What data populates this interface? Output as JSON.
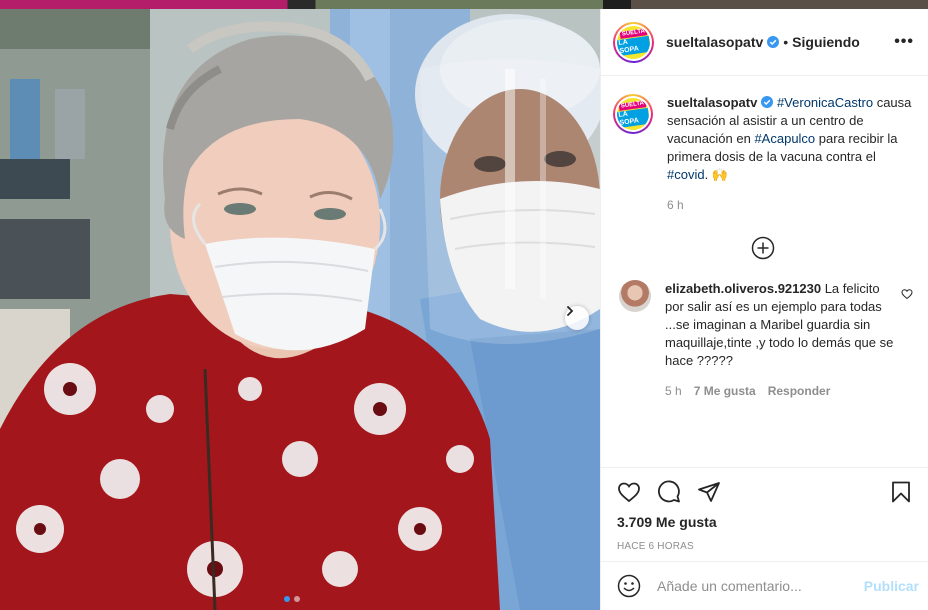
{
  "post": {
    "username": "sueltalasopatv",
    "follow_status": "Siguiendo",
    "bullet": "•",
    "more": "•••",
    "logo_line1": "SUELTA",
    "logo_line2": "LA SOPA"
  },
  "caption": {
    "username": "sueltalasopatv",
    "tag1": "#VeronicaCastro",
    "text1": " causa sensación al asistir a un centro de vacunación en ",
    "tag2": "#Acapulco",
    "text2": " para recibir la primera dosis de la vacuna contra el ",
    "tag3": "#covid",
    "text3": ". ",
    "emoji": "🙌",
    "time": "6 h"
  },
  "comment": {
    "username": "elizabeth.oliveros.921230",
    "text": " La felicito por salir así es un ejemplo para todas ...se imaginan a Maribel guardia sin maquillaje,tinte ,y todo lo demás que se hace ?????",
    "time": "5 h",
    "likes": "7 Me gusta",
    "reply": "Responder"
  },
  "actions": {
    "likes": "3.709 Me gusta",
    "time_ago": "HACE 6 HORAS"
  },
  "add_comment": {
    "placeholder": "Añade un comentario...",
    "publish": "Publicar"
  },
  "carousel": {
    "current": 1,
    "total": 2
  },
  "colors": {
    "verified": "#3897f0",
    "link": "#00376b",
    "secondary": "#8e8e8e",
    "publish_disabled": "#b2dffc"
  },
  "icons": [
    "verified-icon",
    "more-icon",
    "add-circle-icon",
    "heart-icon",
    "comment-icon",
    "share-icon",
    "bookmark-icon",
    "emoji-icon",
    "chevron-right-icon"
  ]
}
